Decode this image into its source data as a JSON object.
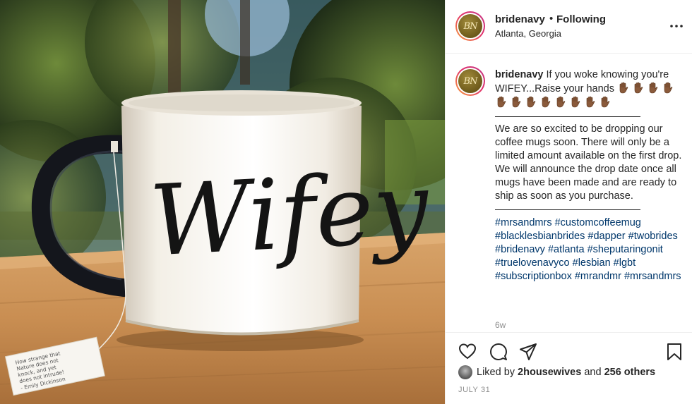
{
  "post": {
    "author": {
      "username": "bridenavy",
      "avatar_initials": "BN",
      "follow_status": "Following",
      "separator": "•",
      "location": "Atlanta, Georgia"
    },
    "more_icon": "more-horizontal-icon",
    "photo": {
      "mug_text": "Wifey",
      "tea_tag_lines": [
        "How strange that",
        "Nature does not",
        "knock, and yet",
        "does not intrude!",
        "- Emily Dickinson"
      ]
    },
    "caption": {
      "username": "bridenavy",
      "line1": "If you woke knowing you're WIFEY...Raise your hands",
      "emoji": "raised-hand-medium-dark-skin-tone",
      "emoji_count": 12,
      "body": "We are so excited to be dropping our coffee mugs soon. There will only be a limited amount available on the first drop. We will announce the drop date once all mugs have been made and are ready to ship as soon as you purchase.",
      "hashtags": [
        "#mrsandmrs",
        "#customcoffeemug",
        "#blacklesbianbrides",
        "#dapper",
        "#twobrides",
        "#bridenavy",
        "#atlanta",
        "#sheputaringonit",
        "#truelovenavyco",
        "#lesbian",
        "#lgbt",
        "#subscriptionbox",
        "#mrandmr",
        "#mrsandmrs"
      ],
      "age": "6w"
    },
    "actions": {
      "like_icon": "heart-icon",
      "comment_icon": "comment-icon",
      "share_icon": "paper-plane-icon",
      "save_icon": "bookmark-icon"
    },
    "likes": {
      "prefix": "Liked by",
      "user": "2housewives",
      "and": "and",
      "others": "256 others"
    },
    "date": "JULY 31"
  }
}
